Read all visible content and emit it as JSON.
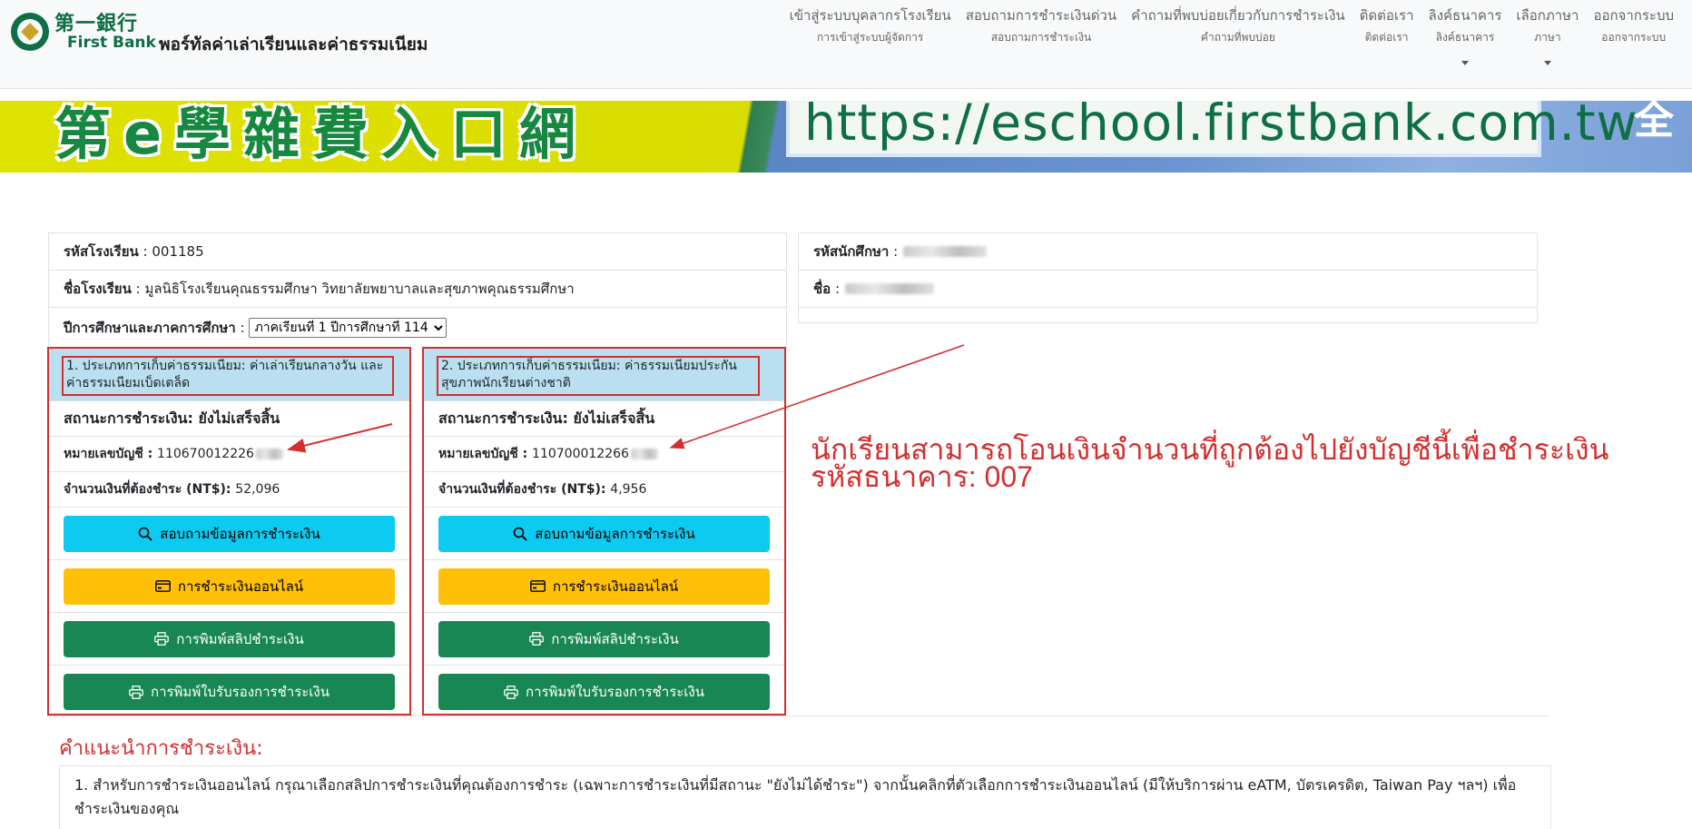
{
  "brand": {
    "logo_line1": "第一銀行",
    "logo_line2": "First Bank",
    "portal_title": "พอร์ทัลค่าเล่าเรียนและค่าธรรมเนียม"
  },
  "nav": [
    {
      "main": "เข้าสู่ระบบบุคลากรโรงเรียน",
      "sub": "การเข้าสู่ระบบผู้จัดการ",
      "caret": false
    },
    {
      "main": "สอบถามการชำระเงินด่วน",
      "sub": "สอบถามการชำระเงิน",
      "caret": false
    },
    {
      "main": "คำถามที่พบบ่อยเกี่ยวกับการชำระเงิน",
      "sub": "คำถามที่พบบ่อย",
      "caret": false
    },
    {
      "main": "ติดต่อเรา",
      "sub": "ติดต่อเรา",
      "caret": false
    },
    {
      "main": "ลิงค์ธนาคาร",
      "sub": "ลิงค์ธนาคาร",
      "caret": true
    },
    {
      "main": "เลือกภาษา",
      "sub": "ภาษา",
      "caret": true
    },
    {
      "main": "ออกจากระบบ",
      "sub": "ออกจากระบบ",
      "caret": false
    }
  ],
  "banner": {
    "chars": "第e學雜費入口網",
    "url": "https://eschool.firstbank.com.tw",
    "side": "全"
  },
  "school": {
    "code_label": "รหัสโรงเรียน",
    "code_value": "001185",
    "name_label": "ชื่อโรงเรียน",
    "name_value": "มูลนิธิโรงเรียนคุณธรรมศึกษา วิทยาลัยพยาบาลและสุขภาพคุณธรรมศึกษา",
    "term_label": "ปีการศึกษาและภาคการศึกษา",
    "term_selected": "ภาคเรียนที่ 1 ปีการศึกษาที่ 114"
  },
  "student": {
    "id_label": "รหัสนักศึกษา",
    "name_label": "ชื่อ"
  },
  "cards": [
    {
      "title": "1. ประเภทการเก็บค่าธรรมเนียม: ค่าเล่าเรียนกลางวัน และค่าธรรมเนียมเบ็ดเตล็ด",
      "status": "สถานะการชำระเงิน: ยังไม่เสร็จสิ้น",
      "account_label": "หมายเลขบัญชี :",
      "account_value": "110670012226",
      "amount_label": "จำนวนเงินที่ต้องชำระ (NT$):",
      "amount_value": "52,096"
    },
    {
      "title": "2. ประเภทการเก็บค่าธรรมเนียม: ค่าธรรมเนียมประกันสุขภาพนักเรียนต่างชาติ",
      "status": "สถานะการชำระเงิน: ยังไม่เสร็จสิ้น",
      "account_label": "หมายเลขบัญชี :",
      "account_value": "110700012266",
      "amount_label": "จำนวนเงินที่ต้องชำระ (NT$):",
      "amount_value": "4,956"
    }
  ],
  "buttons": {
    "inquiry": "สอบถามข้อมูลการชำระเงิน",
    "online": "การชำระเงินออนไลน์",
    "print_slip": "การพิมพ์สลิปชำระเงิน",
    "print_receipt": "การพิมพ์ใบรับรองการชำระเงิน"
  },
  "annotation": {
    "line1": "นักเรียนสามารถโอนเงินจำนวนที่ถูกต้องไปยังบัญชีนี้เพื่อชำระเงิน",
    "line2": "รหัสธนาคาร: 007"
  },
  "instructions": {
    "title": "คำแนะนำการชำระเงิน:",
    "item1": "1. สำหรับการชำระเงินออนไลน์ กรุณาเลือกสลิปการชำระเงินที่คุณต้องการชำระ (เฉพาะการชำระเงินที่มีสถานะ \"ยังไม่ได้ชำระ\") จากนั้นคลิกที่ตัวเลือกการชำระเงินออนไลน์ (มีให้บริการผ่าน eATM, บัตรเครดิต, Taiwan Pay ฯลฯ) เพื่อชำระเงินของคุณ"
  },
  "colors": {
    "brand_green": "#0e6e45",
    "card_header": "#b9dff0",
    "annotation_red": "#d32f2f",
    "btn_info": "#0dcaf0",
    "btn_warning": "#ffc107",
    "btn_success": "#198754"
  }
}
